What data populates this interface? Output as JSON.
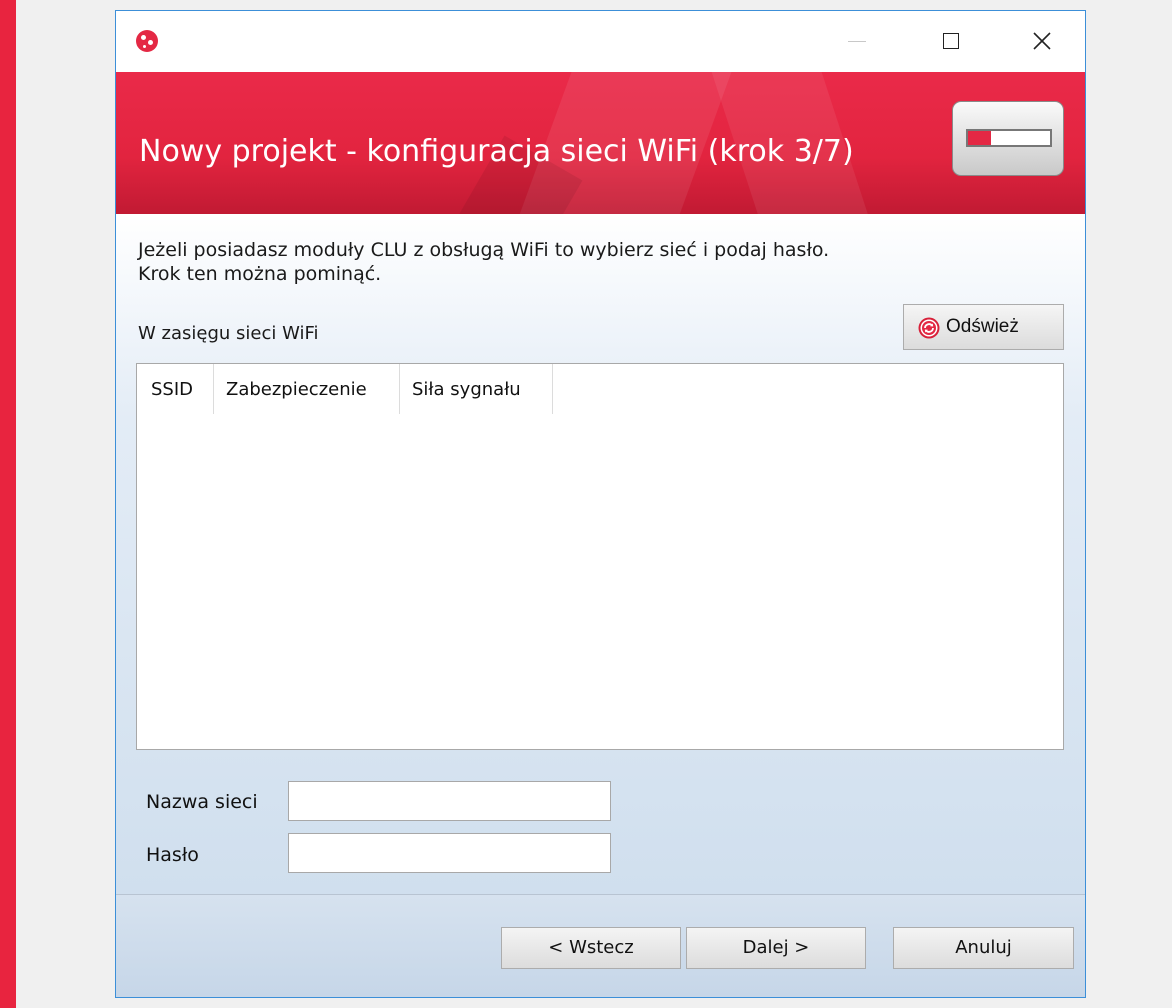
{
  "window": {
    "banner_title": "Nowy projekt - konfiguracja sieci WiFi (krok 3/7)",
    "progress_fraction": 0.2857
  },
  "content": {
    "intro_line1": "Jeżeli posiadasz moduły CLU z obsługą WiFi to wybierz sieć i podaj hasło.",
    "intro_line2": "Krok ten można pominąć.",
    "section_label": "W zasięgu sieci WiFi",
    "refresh_label": "Odśwież",
    "table": {
      "columns": [
        "SSID",
        "Zabezpieczenie",
        "Siła sygnału"
      ],
      "rows": []
    },
    "fields": {
      "network_name_label": "Nazwa sieci",
      "network_name_value": "",
      "password_label": "Hasło",
      "password_value": ""
    }
  },
  "footer": {
    "back_label": "< Wstecz",
    "next_label": "Dalej >",
    "cancel_label": "Anuluj"
  },
  "colors": {
    "brand_red": "#e42844",
    "window_border": "#3c8fd8"
  }
}
